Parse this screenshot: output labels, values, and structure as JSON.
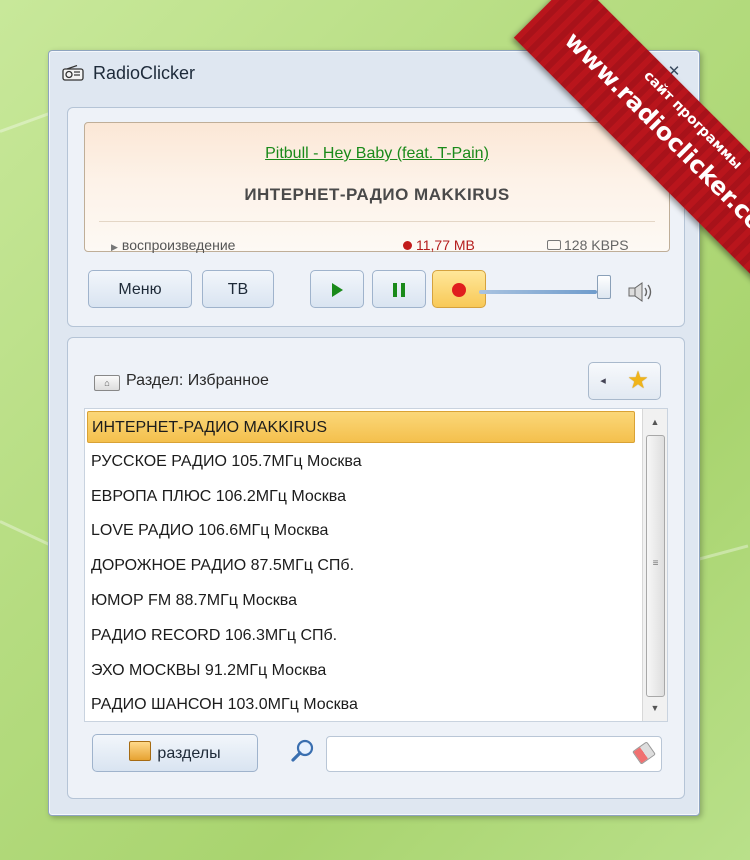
{
  "window": {
    "title": "RadioClicker",
    "controls": {
      "minimize": "▭",
      "maximize": "▢",
      "close": "✕"
    }
  },
  "ribbon": {
    "small": "сайт программы",
    "big": "www.radioclicker.com",
    "color": "#b9151c"
  },
  "display": {
    "track": "Pitbull - Hey Baby (feat. T-Pain)",
    "station": "ИНТЕРНЕТ-РАДИО  MAKKIRUS",
    "status": "воспроизведение",
    "recorded_size": "11,77 MB",
    "bitrate": "128 KBPS"
  },
  "controls": {
    "menu_label": "Меню",
    "tv_label": "ТВ",
    "volume": 0.9
  },
  "section": {
    "label": "Раздел: Избранное"
  },
  "stations": [
    "ИНТЕРНЕТ-РАДИО MAKKIRUS",
    "РУССКОЕ РАДИО 105.7МГц Москва",
    "ЕВРОПА ПЛЮС 106.2МГц Москва",
    "LOVE РАДИО 106.6МГц Москва",
    "ДОРОЖНОЕ РАДИО 87.5МГц СПб.",
    "ЮМОР FM 88.7МГц Москва",
    "РАДИО RECORD 106.3МГц СПб.",
    "ЭХО МОСКВЫ 91.2МГц Москва",
    "РАДИО ШАНСОН 103.0МГц Москва"
  ],
  "selected_station_index": 0,
  "footer": {
    "sections_label": "разделы",
    "search_value": ""
  },
  "colors": {
    "accent_green": "#1a8a1a",
    "record_red": "#e01e1e",
    "selection": "#f4c04d"
  }
}
